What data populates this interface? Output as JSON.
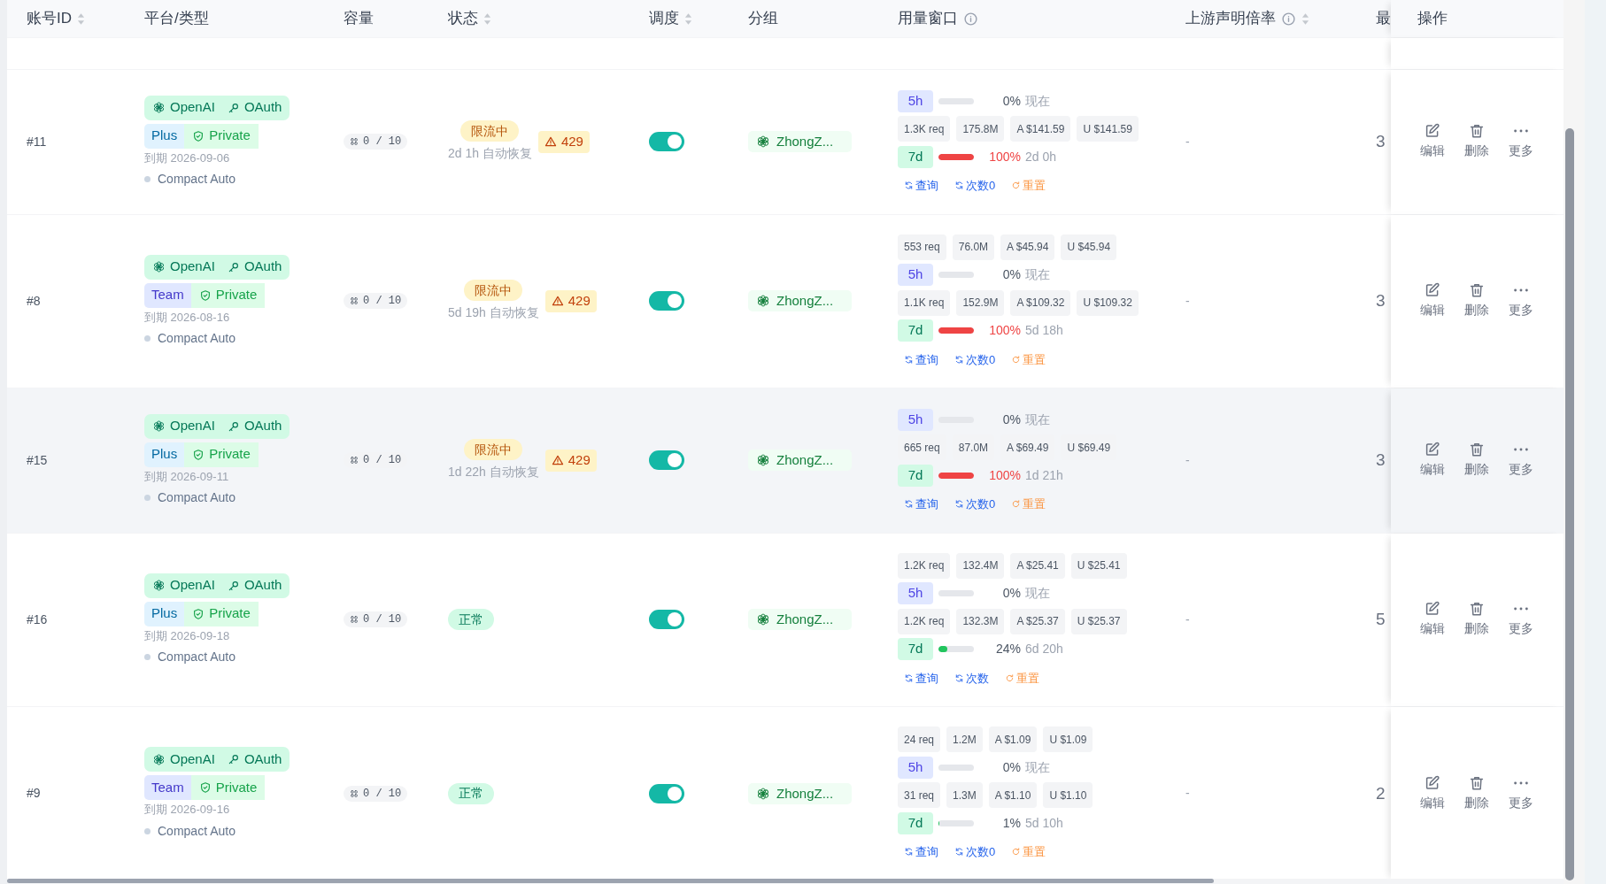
{
  "columns": [
    {
      "label": "账号ID",
      "sortable": true
    },
    {
      "label": "平台/类型"
    },
    {
      "label": "容量"
    },
    {
      "label": "状态",
      "sortable": true
    },
    {
      "label": "调度",
      "sortable": true
    },
    {
      "label": "分组"
    },
    {
      "label": "用量窗口",
      "info": true
    },
    {
      "label": "上游声明倍率",
      "info": true,
      "sortable": true
    },
    {
      "label": "最"
    },
    {
      "label": "操作"
    }
  ],
  "rows": [
    {
      "id": "#11",
      "hovered": false,
      "platform": "OpenAI",
      "auth": "OAuth",
      "plan": {
        "label": "Plus",
        "kind": "plus"
      },
      "privacy": "Private",
      "expiry": "到期 2026-09-06",
      "mode": "Compact Auto",
      "capacity": "0 / 10",
      "status": {
        "kind": "limited",
        "label": "限流中",
        "recovery": "2d 1h 自动恢复",
        "code": "429"
      },
      "scheduling": {
        "on": true
      },
      "group": "ZhongZ...",
      "usage": [
        {
          "kind": "window",
          "period": "5h",
          "level": 0,
          "percent": "0%",
          "reset": "现在"
        },
        {
          "kind": "stats",
          "chips": [
            "1.3K req",
            "175.8M",
            "A $141.59",
            "U $141.59"
          ]
        },
        {
          "kind": "window",
          "period": "7d",
          "level": 1,
          "percent": "100%",
          "reset": "2d 0h"
        }
      ],
      "links": [
        {
          "kind": "query",
          "label": "查询"
        },
        {
          "kind": "count",
          "label": "次数0"
        },
        {
          "kind": "reset",
          "label": "重置"
        }
      ],
      "upstream": "-",
      "last": "3",
      "actions": [
        "编辑",
        "删除",
        "更多"
      ]
    },
    {
      "id": "#8",
      "hovered": false,
      "platform": "OpenAI",
      "auth": "OAuth",
      "plan": {
        "label": "Team",
        "kind": "team"
      },
      "privacy": "Private",
      "expiry": "到期 2026-08-16",
      "mode": "Compact Auto",
      "capacity": "0 / 10",
      "status": {
        "kind": "limited",
        "label": "限流中",
        "recovery": "5d 19h 自动恢复",
        "code": "429"
      },
      "scheduling": {
        "on": true
      },
      "group": "ZhongZ...",
      "usage": [
        {
          "kind": "stats",
          "chips": [
            "553 req",
            "76.0M",
            "A $45.94",
            "U $45.94"
          ]
        },
        {
          "kind": "window",
          "period": "5h",
          "level": 0,
          "percent": "0%",
          "reset": "现在"
        },
        {
          "kind": "stats",
          "chips": [
            "1.1K req",
            "152.9M",
            "A $109.32",
            "U $109.32"
          ]
        },
        {
          "kind": "window",
          "period": "7d",
          "level": 1,
          "percent": "100%",
          "reset": "5d 18h"
        }
      ],
      "links": [
        {
          "kind": "query",
          "label": "查询"
        },
        {
          "kind": "count",
          "label": "次数0"
        },
        {
          "kind": "reset",
          "label": "重置"
        }
      ],
      "upstream": "-",
      "last": "3",
      "actions": [
        "编辑",
        "删除",
        "更多"
      ]
    },
    {
      "id": "#15",
      "hovered": true,
      "platform": "OpenAI",
      "auth": "OAuth",
      "plan": {
        "label": "Plus",
        "kind": "plus"
      },
      "privacy": "Private",
      "expiry": "到期 2026-09-11",
      "mode": "Compact Auto",
      "capacity": "0 / 10",
      "status": {
        "kind": "limited",
        "label": "限流中",
        "recovery": "1d 22h 自动恢复",
        "code": "429"
      },
      "scheduling": {
        "on": true
      },
      "group": "ZhongZ...",
      "usage": [
        {
          "kind": "window",
          "period": "5h",
          "level": 0,
          "percent": "0%",
          "reset": "现在"
        },
        {
          "kind": "stats",
          "chips": [
            "665 req",
            "87.0M",
            "A $69.49",
            "U $69.49"
          ]
        },
        {
          "kind": "window",
          "period": "7d",
          "level": 1,
          "percent": "100%",
          "reset": "1d 21h"
        }
      ],
      "links": [
        {
          "kind": "query",
          "label": "查询"
        },
        {
          "kind": "count",
          "label": "次数0"
        },
        {
          "kind": "reset",
          "label": "重置"
        }
      ],
      "upstream": "-",
      "last": "3",
      "actions": [
        "编辑",
        "删除",
        "更多"
      ]
    },
    {
      "id": "#16",
      "hovered": false,
      "platform": "OpenAI",
      "auth": "OAuth",
      "plan": {
        "label": "Plus",
        "kind": "plus"
      },
      "privacy": "Private",
      "expiry": "到期 2026-09-18",
      "mode": "Compact Auto",
      "capacity": "0 / 10",
      "status": {
        "kind": "normal",
        "label": "正常"
      },
      "scheduling": {
        "on": true
      },
      "group": "ZhongZ...",
      "usage": [
        {
          "kind": "stats",
          "chips": [
            "1.2K req",
            "132.4M",
            "A $25.41",
            "U $25.41"
          ]
        },
        {
          "kind": "window",
          "period": "5h",
          "level": 0,
          "percent": "0%",
          "reset": "现在"
        },
        {
          "kind": "stats",
          "chips": [
            "1.2K req",
            "132.3M",
            "A $25.37",
            "U $25.37"
          ]
        },
        {
          "kind": "window",
          "period": "7d",
          "level": 0.24,
          "percent": "24%",
          "reset": "6d 20h"
        }
      ],
      "links": [
        {
          "kind": "query",
          "label": "查询"
        },
        {
          "kind": "count",
          "label": "次数"
        },
        {
          "kind": "reset",
          "label": "重置"
        }
      ],
      "upstream": "-",
      "last": "5",
      "actions": [
        "编辑",
        "删除",
        "更多"
      ]
    },
    {
      "id": "#9",
      "hovered": false,
      "platform": "OpenAI",
      "auth": "OAuth",
      "plan": {
        "label": "Team",
        "kind": "team"
      },
      "privacy": "Private",
      "expiry": "到期 2026-09-16",
      "mode": "Compact Auto",
      "capacity": "0 / 10",
      "status": {
        "kind": "normal",
        "label": "正常"
      },
      "scheduling": {
        "on": true
      },
      "group": "ZhongZ...",
      "usage": [
        {
          "kind": "stats",
          "chips": [
            "24 req",
            "1.2M",
            "A $1.09",
            "U $1.09"
          ]
        },
        {
          "kind": "window",
          "period": "5h",
          "level": 0,
          "percent": "0%",
          "reset": "现在"
        },
        {
          "kind": "stats",
          "chips": [
            "31 req",
            "1.3M",
            "A $1.10",
            "U $1.10"
          ]
        },
        {
          "kind": "window",
          "period": "7d",
          "level": 0.01,
          "percent": "1%",
          "reset": "5d 10h"
        }
      ],
      "links": [
        {
          "kind": "query",
          "label": "查询"
        },
        {
          "kind": "count",
          "label": "次数0"
        },
        {
          "kind": "reset",
          "label": "重置"
        }
      ],
      "upstream": "-",
      "last": "2",
      "actions": [
        "编辑",
        "删除",
        "更多"
      ]
    }
  ]
}
